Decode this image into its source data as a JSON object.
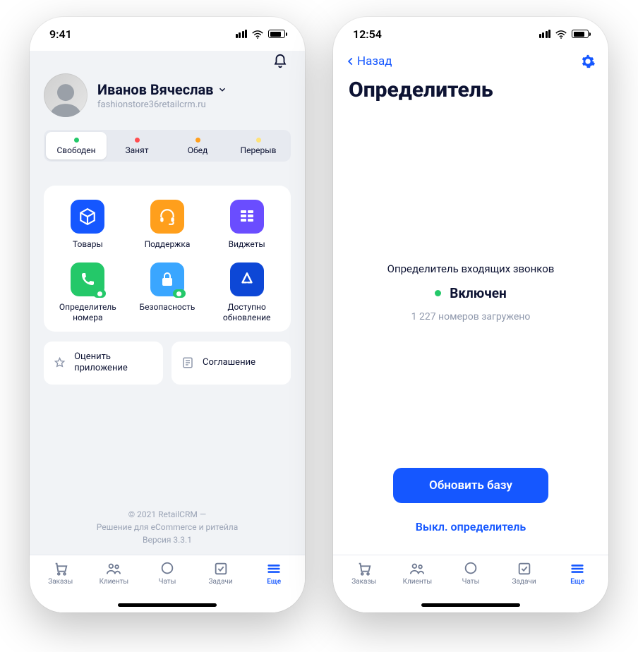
{
  "phone1": {
    "status_time": "9:41",
    "user": {
      "name": "Иванов Вячеслав",
      "domain": "fashionstore36retailcrm.ru"
    },
    "statuses": [
      {
        "label": "Свободен",
        "dot": "#24c869",
        "active": true
      },
      {
        "label": "Занят",
        "dot": "#ff4d4f",
        "active": false
      },
      {
        "label": "Обед",
        "dot": "#ff9f1c",
        "active": false
      },
      {
        "label": "Перерыв",
        "dot": "#ffe37a",
        "active": false
      }
    ],
    "grid": [
      {
        "label": "Товары",
        "bg": "#1557ff",
        "icon": "cube",
        "badge": false
      },
      {
        "label": "Поддержка",
        "bg": "#ff9f1c",
        "icon": "headset",
        "badge": false
      },
      {
        "label": "Виджеты",
        "bg": "#6a4dff",
        "icon": "widgets",
        "badge": false
      },
      {
        "label": "Определитель номера",
        "bg": "#24c869",
        "icon": "phone",
        "badge": true
      },
      {
        "label": "Безопасность",
        "bg": "#3aa6ff",
        "icon": "lock",
        "badge": true
      },
      {
        "label": "Доступно обновление",
        "bg": "#0d47d6",
        "icon": "appstore",
        "badge": false
      }
    ],
    "cards": {
      "rate": "Оценить приложение",
      "agreement": "Соглашение"
    },
    "footer": {
      "line1": "© 2021 RetailCRM —",
      "line2": "Решение для eCommerce и ритейла",
      "line3": "Версия 3.3.1"
    }
  },
  "phone2": {
    "status_time": "12:54",
    "back": "Назад",
    "title": "Определитель",
    "subtitle": "Определитель входящих звонков",
    "state": "Включен",
    "count": "1 227 номеров загружено",
    "update_btn": "Обновить базу",
    "disable_link": "Выкл. определитель"
  },
  "tabs": [
    {
      "label": "Заказы",
      "icon": "cart"
    },
    {
      "label": "Клиенты",
      "icon": "people"
    },
    {
      "label": "Чаты",
      "icon": "chat"
    },
    {
      "label": "Задачи",
      "icon": "task"
    },
    {
      "label": "Еще",
      "icon": "more"
    }
  ]
}
